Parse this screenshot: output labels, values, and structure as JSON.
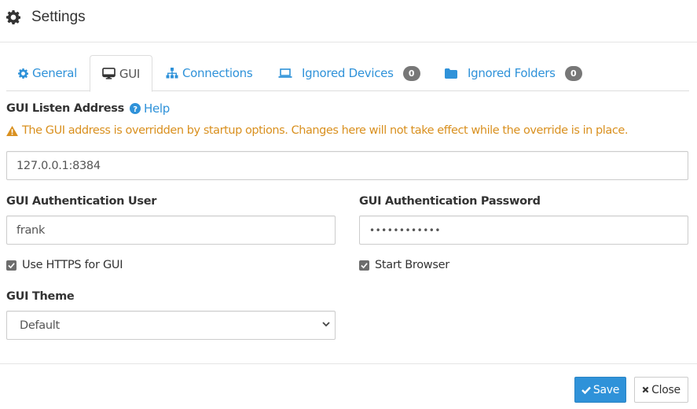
{
  "header": {
    "title": "Settings",
    "icon": "gear-icon"
  },
  "tabs": [
    {
      "label": "General",
      "icon": "gear-icon",
      "active": false
    },
    {
      "label": "GUI",
      "icon": "desktop-icon",
      "active": true
    },
    {
      "label": "Connections",
      "icon": "sitemap-icon",
      "active": false
    },
    {
      "label": "Ignored Devices",
      "icon": "laptop-icon",
      "active": false,
      "badge": "0"
    },
    {
      "label": "Ignored Folders",
      "icon": "folder-icon",
      "active": false,
      "badge": "0"
    }
  ],
  "form": {
    "listen_address": {
      "label": "GUI Listen Address",
      "help_label": "Help",
      "warning": "The GUI address is overridden by startup options. Changes here will not take effect while the override is in place.",
      "value": "127.0.0.1:8384"
    },
    "auth_user": {
      "label": "GUI Authentication User",
      "value": "frank"
    },
    "auth_password": {
      "label": "GUI Authentication Password",
      "value": "••••••••••••"
    },
    "use_https": {
      "label": "Use HTTPS for GUI",
      "checked": true
    },
    "start_browser": {
      "label": "Start Browser",
      "checked": true
    },
    "theme": {
      "label": "GUI Theme",
      "selected": "Default"
    }
  },
  "footer": {
    "save_label": "Save",
    "close_label": "Close"
  },
  "colors": {
    "accent": "#2f92d9",
    "warning": "#d9901f",
    "badge": "#777777"
  }
}
